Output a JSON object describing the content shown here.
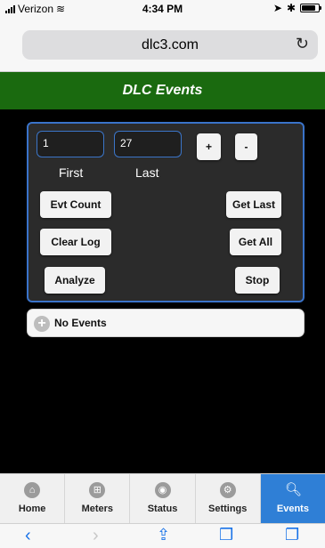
{
  "status_bar": {
    "carrier": "Verizon",
    "time": "4:34 PM",
    "icons": [
      "wifi-icon",
      "location-icon",
      "bluetooth-icon",
      "battery-icon"
    ]
  },
  "browser": {
    "url": "dlc3.com",
    "reload_icon": "reload-icon"
  },
  "header": {
    "title": "DLC Events"
  },
  "controls": {
    "first": {
      "value": "1",
      "label": "First"
    },
    "last": {
      "value": "27",
      "label": "Last"
    },
    "increment_label": "+",
    "decrement_label": "-",
    "buttons": {
      "evt_count": "Evt Count",
      "get_last": "Get Last",
      "clear_log": "Clear Log",
      "get_all": "Get All",
      "analyze": "Analyze",
      "stop": "Stop"
    }
  },
  "events": {
    "items": [
      {
        "label": "No Events"
      }
    ]
  },
  "tabs": [
    {
      "label": "Home",
      "icon": "home-icon",
      "active": false
    },
    {
      "label": "Meters",
      "icon": "grid-icon",
      "active": false
    },
    {
      "label": "Status",
      "icon": "eye-icon",
      "active": false
    },
    {
      "label": "Settings",
      "icon": "gear-icon",
      "active": false
    },
    {
      "label": "Events",
      "icon": "search-icon",
      "active": true
    }
  ],
  "colors": {
    "header_bg": "#1a6a0f",
    "panel_border": "#3a73c9",
    "active_tab": "#2f7fd6",
    "ios_blue": "#1a73e8"
  }
}
